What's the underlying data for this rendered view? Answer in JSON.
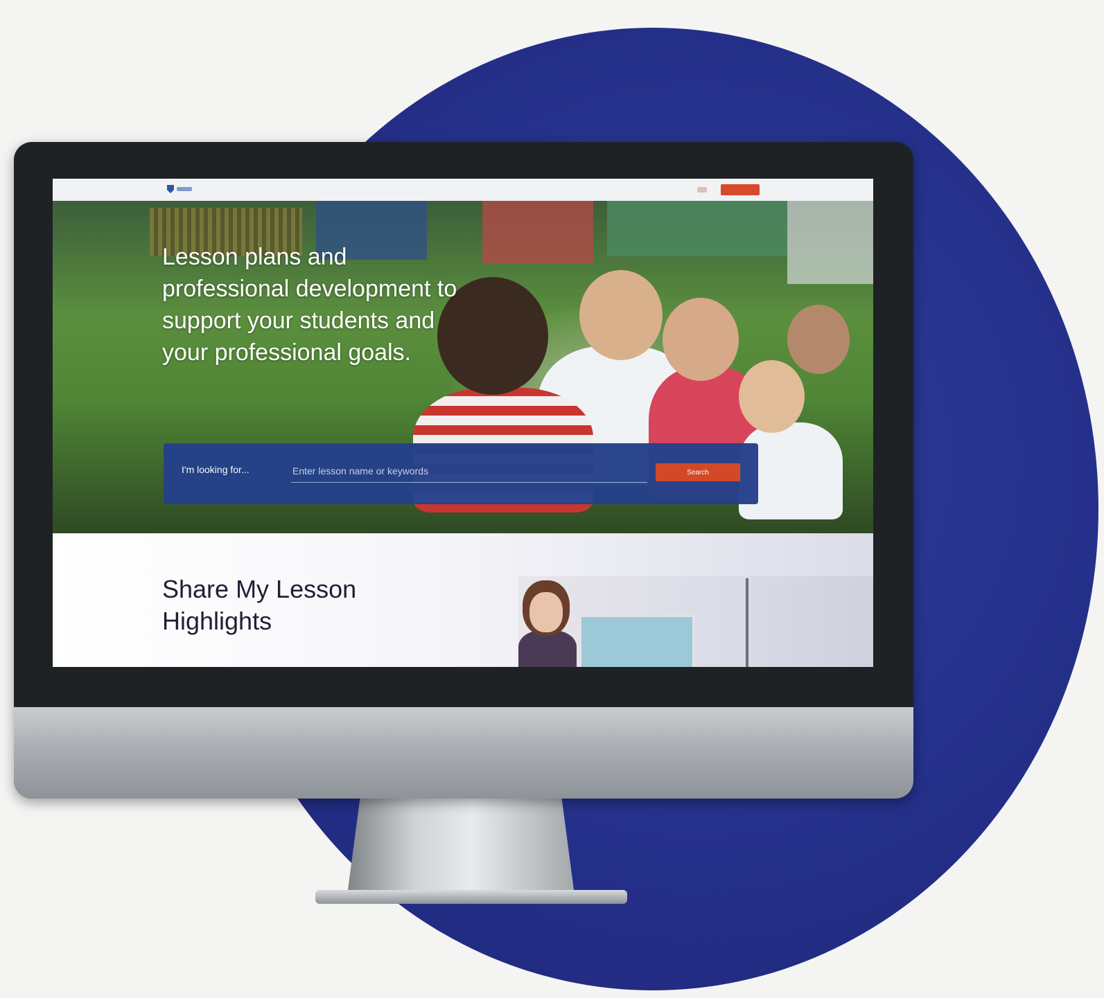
{
  "nav": {
    "links": [
      "",
      "",
      "",
      ""
    ],
    "cta_label": ""
  },
  "hero": {
    "title": "Lesson plans and professional development to support your students and your professional goals."
  },
  "search": {
    "label": "I'm looking for...",
    "placeholder": "Enter lesson name or keywords",
    "button_label": "Search",
    "advanced_link": ""
  },
  "highlights": {
    "title": "Share My Lesson Highlights"
  },
  "colors": {
    "circle": "#25308a",
    "search_panel": "#25418a",
    "cta": "#d24a26",
    "nav_active": "#e6702e"
  },
  "icons": [
    "logo-shield-icon"
  ]
}
